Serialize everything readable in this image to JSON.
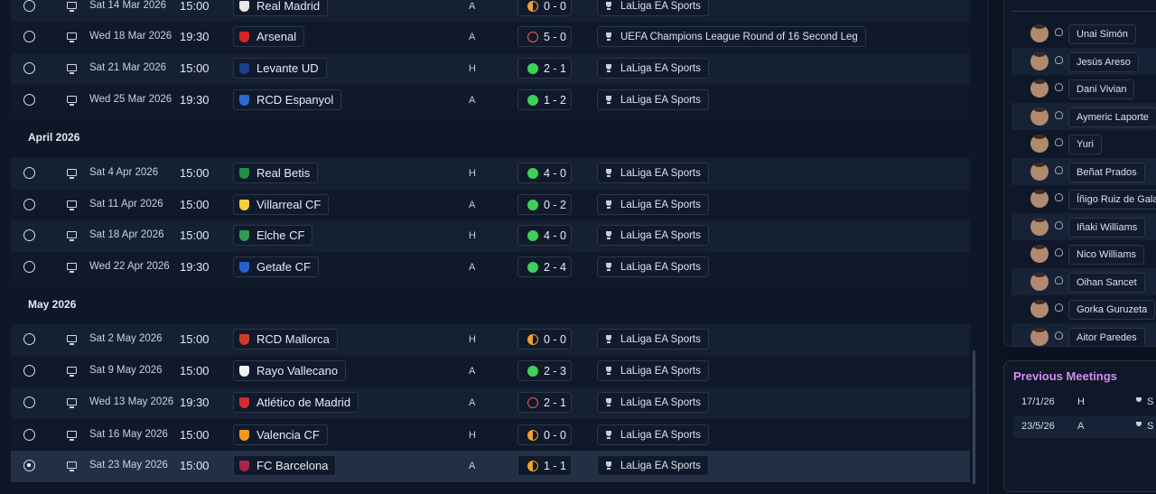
{
  "months": [
    "April 2026",
    "May 2026"
  ],
  "fixtures": [
    {
      "date": "Sat 14 Mar 2026",
      "time": "15:00",
      "team": "Real Madrid",
      "venue": "A",
      "result": "D",
      "score": "0 - 0",
      "competition": "LaLiga EA Sports",
      "crest": "#e8e8e8",
      "selected": false
    },
    {
      "date": "Wed 18 Mar 2026",
      "time": "19:30",
      "team": "Arsenal",
      "venue": "A",
      "result": "L",
      "score": "5 - 0",
      "competition": "UEFA Champions League Round of 16  Second Leg",
      "crest": "#d6242b",
      "selected": false
    },
    {
      "date": "Sat 21 Mar 2026",
      "time": "15:00",
      "team": "Levante UD",
      "venue": "H",
      "result": "W",
      "score": "2 - 1",
      "competition": "LaLiga EA Sports",
      "crest": "#1d3f8a",
      "selected": false
    },
    {
      "date": "Wed 25 Mar 2026",
      "time": "19:30",
      "team": "RCD Espanyol",
      "venue": "A",
      "result": "W",
      "score": "1 - 2",
      "competition": "LaLiga EA Sports",
      "crest": "#2a6bd1",
      "selected": false
    },
    {
      "date": "Sat 4 Apr 2026",
      "time": "15:00",
      "team": "Real Betis",
      "venue": "H",
      "result": "W",
      "score": "4 - 0",
      "competition": "LaLiga EA Sports",
      "crest": "#1f8f45",
      "selected": false
    },
    {
      "date": "Sat 11 Apr 2026",
      "time": "15:00",
      "team": "Villarreal CF",
      "venue": "A",
      "result": "W",
      "score": "0 - 2",
      "competition": "LaLiga EA Sports",
      "crest": "#f2d23a",
      "selected": false
    },
    {
      "date": "Sat 18 Apr 2026",
      "time": "15:00",
      "team": "Elche CF",
      "venue": "H",
      "result": "W",
      "score": "4 - 0",
      "competition": "LaLiga EA Sports",
      "crest": "#2e9a55",
      "selected": false
    },
    {
      "date": "Wed 22 Apr 2026",
      "time": "19:30",
      "team": "Getafe CF",
      "venue": "A",
      "result": "W",
      "score": "2 - 4",
      "competition": "LaLiga EA Sports",
      "crest": "#2a5fd0",
      "selected": false
    },
    {
      "date": "Sat 2 May 2026",
      "time": "15:00",
      "team": "RCD Mallorca",
      "venue": "H",
      "result": "D",
      "score": "0 - 0",
      "competition": "LaLiga EA Sports",
      "crest": "#d23a2a",
      "selected": false
    },
    {
      "date": "Sat 9 May 2026",
      "time": "15:00",
      "team": "Rayo Vallecano",
      "venue": "A",
      "result": "W",
      "score": "2 - 3",
      "competition": "LaLiga EA Sports",
      "crest": "#f2f2f2",
      "selected": false
    },
    {
      "date": "Wed 13 May 2026",
      "time": "19:30",
      "team": "Atlético de Madrid",
      "venue": "A",
      "result": "L",
      "score": "2 - 1",
      "competition": "LaLiga EA Sports",
      "crest": "#d42b2b",
      "selected": false
    },
    {
      "date": "Sat 16 May 2026",
      "time": "15:00",
      "team": "Valencia CF",
      "venue": "H",
      "result": "D",
      "score": "0 - 0",
      "competition": "LaLiga EA Sports",
      "crest": "#f09a20",
      "selected": false
    },
    {
      "date": "Sat 23 May 2026",
      "time": "15:00",
      "team": "FC Barcelona",
      "venue": "A",
      "result": "D",
      "score": "1 - 1",
      "competition": "LaLiga EA Sports",
      "crest": "#a8244a",
      "selected": true
    }
  ],
  "squad": [
    "Unai Simón",
    "Jesús Areso",
    "Dani Vivian",
    "Aymeric Laporte",
    "Yuri",
    "Beñat Prados",
    "Íñigo Ruiz de Galar",
    "Iñaki Williams",
    "Nico Williams",
    "Oihan Sancet",
    "Gorka Guruzeta",
    "Aitor Paredes"
  ],
  "previous_meetings": {
    "title": "Previous Meetings",
    "rows": [
      {
        "date": "17/1/26",
        "venue": "H",
        "comp": "S"
      },
      {
        "date": "23/5/26",
        "venue": "A",
        "comp": "S"
      }
    ]
  },
  "colors": {
    "win": "#3fd05a",
    "loss": "#ef5a5a",
    "draw": "#f0a030",
    "meetings_title": "#d88bf0"
  }
}
